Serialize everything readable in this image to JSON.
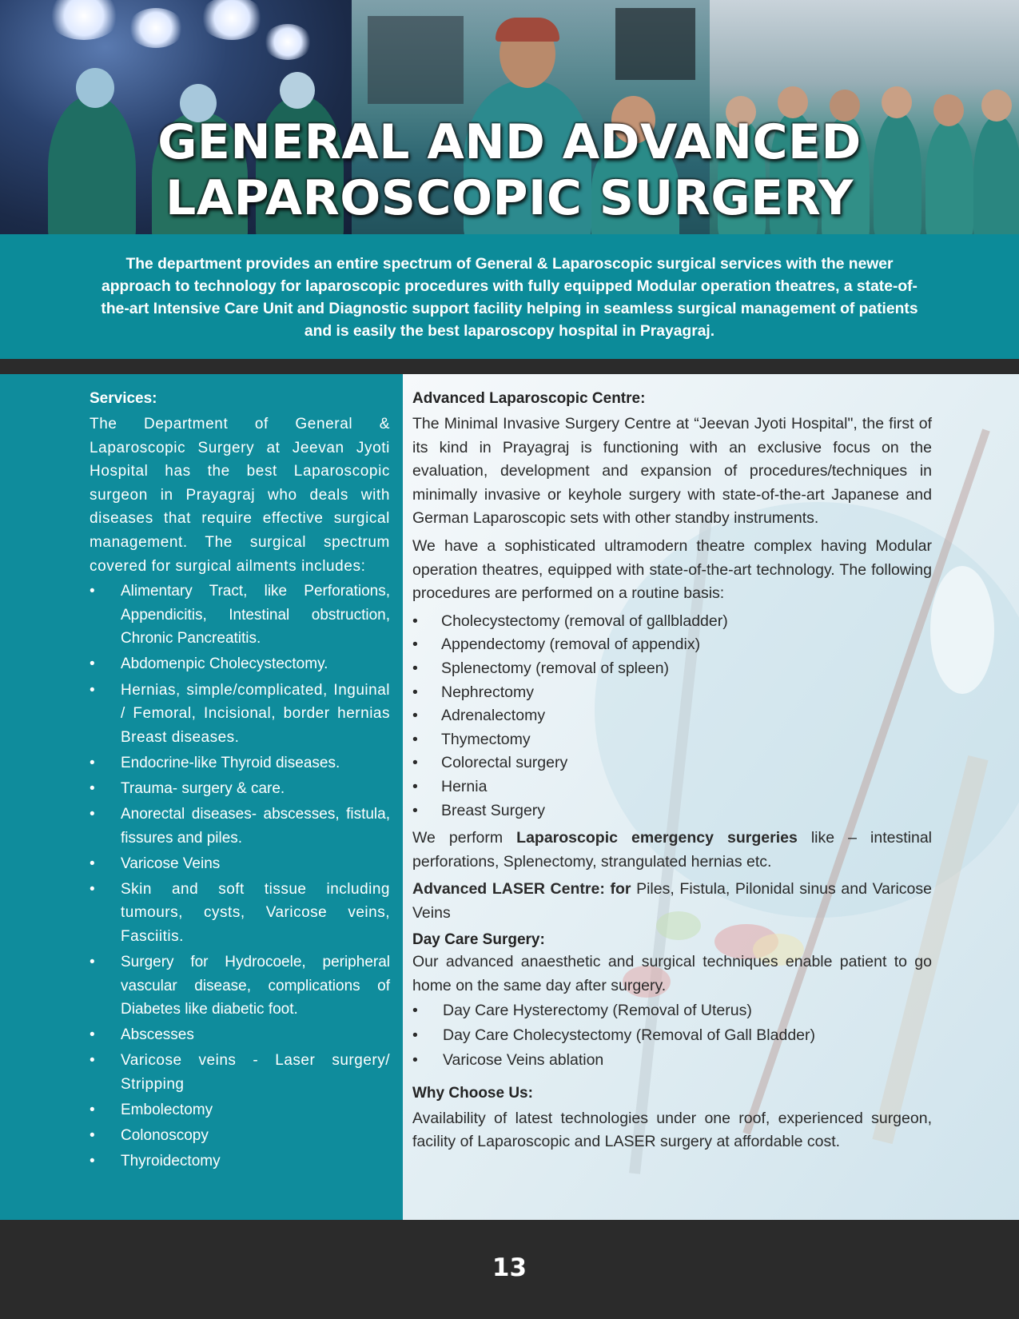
{
  "hero": {
    "title_line1": "GENERAL AND ADVANCED",
    "title_line2": "LAPAROSCOPIC SURGERY"
  },
  "intro": "The department provides an entire spectrum of General & Laparoscopic surgical services with the newer approach to technology for laparoscopic procedures with fully equipped Modular operation theatres, a state-of-the-art Intensive Care Unit and Diagnostic support facility helping in seamless surgical management of patients and is easily the best laparoscopy hospital in Prayagraj.",
  "left": {
    "heading": "Services:",
    "lead": "The Department of General & Laparoscopic Surgery at Jeevan Jyoti Hospital has the best Laparoscopic surgeon in Prayagraj who deals with diseases that require effective surgical management. The surgical spectrum covered for surgical ailments includes:",
    "bullet": "•",
    "items": [
      "Alimentary Tract, like Perforations, Appendicitis, Intestinal obstruction, Chronic Pancreatitis.",
      "Abdomenpic Cholecystectomy.",
      "Hernias, simple/complicated, Inguinal / Femoral, Incisional, border hernias Breast diseases.",
      "Endocrine-like Thyroid diseases.",
      "Trauma- surgery & care.",
      "Anorectal diseases- abscesses, fistula, fissures and piles.",
      "Varicose Veins",
      "Skin and soft tissue including tumours, cysts, Varicose veins, Fasciitis.",
      "Surgery for Hydrocoele, peripheral vascular disease, complications of Diabetes like diabetic foot.",
      "Abscesses",
      "Varicose veins - Laser surgery/ Stripping",
      "Embolectomy",
      "Colonoscopy",
      "Thyroidectomy"
    ]
  },
  "right": {
    "heading": "Advanced Laparoscopic Centre:",
    "para1": "The Minimal Invasive Surgery Centre at “Jeevan Jyoti Hospital\", the first of its kind in Prayagraj is functioning with an exclusive focus on the evaluation, development and expansion of procedures/techniques in minimally invasive or keyhole surgery with state-of-the-art Japanese and German Laparoscopic sets with other standby instruments.",
    "para2": "We have a sophisticated ultramodern theatre complex having Modular operation theatres, equipped with state-of-the-art technology. The following procedures are performed on a routine basis:",
    "procedures": [
      "Cholecystectomy (removal of gallbladder)",
      "Appendectomy (removal of appendix)",
      "Splenectomy (removal of spleen)",
      "Nephrectomy",
      "Adrenalectomy",
      "Thymectomy",
      "Colorectal surgery",
      "Hernia",
      "Breast Surgery"
    ],
    "emergency_pre": "We perform ",
    "emergency_bold": "Laparoscopic emergency surgeries",
    "emergency_post": " like – intestinal perforations, Splenectomy, strangulated hernias etc.",
    "laser_bold": "Advanced LASER Centre: for",
    "laser_rest": " Piles, Fistula, Pilonidal sinus and Varicose Veins",
    "daycare_heading": "Day Care Surgery:",
    "daycare_text": "Our advanced anaesthetic and surgical techniques enable patient to go home on the same day after surgery.",
    "daycare_items": [
      "Day Care Hysterectomy (Removal of Uterus)",
      "Day Care Cholecystectomy (Removal of Gall Bladder)",
      "Varicose Veins ablation"
    ],
    "why_heading": "Why Choose Us:",
    "why_text": "Availability of latest technologies under one roof, experienced surgeon, facility of Laparoscopic and LASER surgery at affordable cost."
  },
  "footer": {
    "page_number": "13"
  }
}
